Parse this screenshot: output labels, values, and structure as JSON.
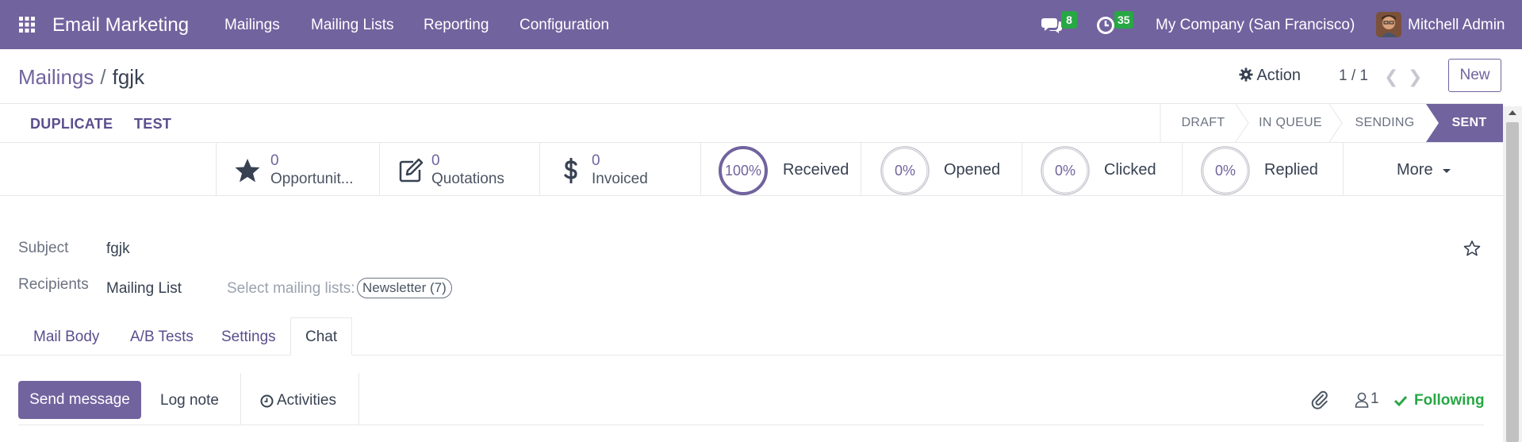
{
  "navbar": {
    "app_title": "Email Marketing",
    "menu": [
      "Mailings",
      "Mailing Lists",
      "Reporting",
      "Configuration"
    ],
    "messages_count": "8",
    "activities_count": "35",
    "company": "My Company (San Francisco)",
    "user": "Mitchell Admin"
  },
  "control_panel": {
    "breadcrumb_parent": "Mailings",
    "breadcrumb_sep": "/",
    "breadcrumb_current": "fgjk",
    "action_label": "Action",
    "pager": "1 / 1",
    "new_label": "New"
  },
  "header": {
    "buttons": [
      "DUPLICATE",
      "TEST"
    ],
    "stages": [
      "DRAFT",
      "IN QUEUE",
      "SENDING",
      "SENT"
    ],
    "active_stage": "SENT"
  },
  "stats": {
    "opportunities": {
      "value": "0",
      "label": "Opportunit..."
    },
    "quotations": {
      "value": "0",
      "label": "Quotations"
    },
    "invoiced": {
      "value": "0",
      "label": "Invoiced"
    },
    "received": {
      "pct": "100%",
      "label": "Received",
      "fraction": 1.0
    },
    "opened": {
      "pct": "0%",
      "label": "Opened",
      "fraction": 0.0
    },
    "clicked": {
      "pct": "0%",
      "label": "Clicked",
      "fraction": 0.0
    },
    "replied": {
      "pct": "0%",
      "label": "Replied",
      "fraction": 0.0
    },
    "more_label": "More"
  },
  "form": {
    "subject_label": "Subject",
    "subject_value": "fgjk",
    "recipients_label": "Recipients",
    "recipients_value": "Mailing List",
    "select_lists_label": "Select mailing lists:",
    "mailing_list_tag": "Newsletter (7)"
  },
  "tabs": [
    "Mail Body",
    "A/B Tests",
    "Settings",
    "Chat"
  ],
  "active_tab": "Chat",
  "chatter": {
    "send_message": "Send message",
    "log_note": "Log note",
    "activities": "Activities",
    "followers_count": "1",
    "following": "Following"
  },
  "colors": {
    "brand": "#71639e",
    "success": "#28a745"
  },
  "icons": [
    "apps-grid-icon",
    "chat-bubbles-icon",
    "clock-icon",
    "gear-icon",
    "chevron-left-icon",
    "chevron-right-icon",
    "star-icon",
    "edit-icon",
    "dollar-icon",
    "caret-down-icon",
    "star-outline-icon",
    "paperclip-icon",
    "user-icon",
    "check-icon"
  ]
}
